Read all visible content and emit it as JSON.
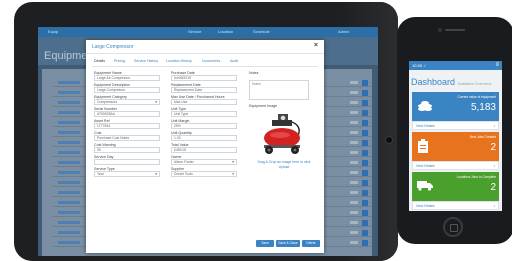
{
  "tablet": {
    "background_app": {
      "title": "Equipment",
      "top_links": [
        "Equip",
        "Service",
        "Location",
        "Schedule",
        "Admin"
      ]
    },
    "modal": {
      "title": "Large Compressor",
      "tabs": [
        "Details",
        "Pricing",
        "Service History",
        "Location History",
        "Documents",
        "Audit"
      ],
      "active_tab": "Details",
      "fields_col1": [
        {
          "label": "Equipment Name",
          "value": "Large Air Compressor"
        },
        {
          "label": "Equipment Description",
          "value": "Large Compressor"
        },
        {
          "label": "Equipment Category",
          "value": "Compressors",
          "select": true
        },
        {
          "label": "Serial Number",
          "value": "AT05928AA"
        },
        {
          "label": "Asset Ref",
          "value": "LT77634"
        },
        {
          "label": "Cost",
          "value": "Purchase Cost Notes"
        },
        {
          "label": "Cost Warning",
          "value": "30"
        },
        {
          "label": "Service Day",
          "value": ""
        },
        {
          "label": "Service Type",
          "value": "Year",
          "select": true
        }
      ],
      "fields_col2": [
        {
          "label": "Purchase Date",
          "value": "04/05/2019"
        },
        {
          "label": "Replacement Date",
          "value": "Replacement Date"
        },
        {
          "label": "Max Use Date / Purchased Hours",
          "value": "Max Use"
        },
        {
          "label": "Unit Type",
          "value": "Unit Type"
        },
        {
          "label": "Unit Margin",
          "value": "25%"
        },
        {
          "label": "Unit Quantity",
          "value": "1.00"
        },
        {
          "label": "Total Value",
          "value": "£450.00"
        },
        {
          "label": "Owner",
          "value": "Alison Foster",
          "select": true
        },
        {
          "label": "Supplier",
          "value": "Dorset Tools",
          "select": true
        }
      ],
      "notes_label": "Notes",
      "notes_placeholder": "Notes",
      "image_label": "Equipment Image",
      "drop_text": "Drag & Drop an image here or click Upload",
      "buttons": [
        "Save",
        "Save & Close",
        "Delete"
      ]
    }
  },
  "phone": {
    "status": "10:35 ✓",
    "menu_icon": "hamburger-icon",
    "title": "Dashboard",
    "subtitle": "Statistics Overview",
    "cards": [
      {
        "caption": "Current value of equipment",
        "value": "5,183",
        "color": "#3b84c4",
        "icon": "coins-icon",
        "footer": "View Details"
      },
      {
        "caption": "New Jobs Created",
        "value": "2",
        "color": "#e8731f",
        "icon": "clipboard-icon",
        "footer": "View Details"
      },
      {
        "caption": "Locations Jobs to Complete",
        "value": "2",
        "color": "#4aa02c",
        "icon": "truck-icon",
        "footer": "View Details"
      }
    ]
  },
  "colors": {
    "accent": "#3b84c4",
    "orange": "#e8731f",
    "green": "#4aa02c",
    "device": "#1e1f22"
  }
}
